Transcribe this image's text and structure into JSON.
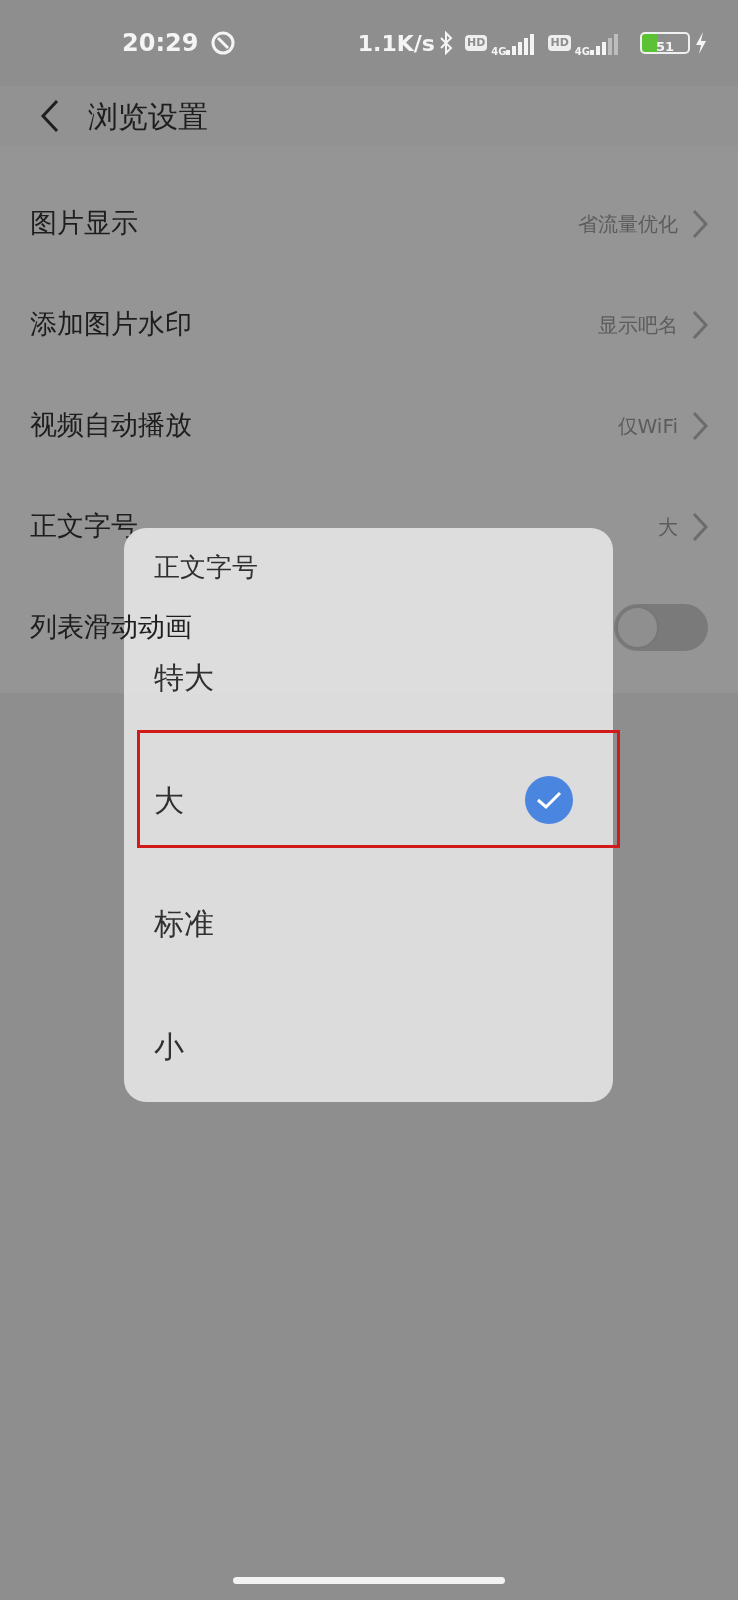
{
  "status_bar": {
    "time": "20:29",
    "speed": "1.1K/s",
    "sims": [
      {
        "hd": "HD",
        "network": "4G"
      },
      {
        "hd": "HD",
        "network": "4G"
      }
    ],
    "battery": "51"
  },
  "header": {
    "title": "浏览设置"
  },
  "settings": [
    {
      "kind": "link",
      "label": "图片显示",
      "value": "省流量优化"
    },
    {
      "kind": "link",
      "label": "添加图片水印",
      "value": "显示吧名"
    },
    {
      "kind": "link",
      "label": "视频自动播放",
      "value": "仅WiFi"
    },
    {
      "kind": "link",
      "label": "正文字号",
      "value": "大"
    },
    {
      "kind": "toggle",
      "label": "列表滑动动画",
      "on": false
    }
  ],
  "dialog": {
    "title": "正文字号",
    "options": [
      {
        "label": "特大",
        "selected": false,
        "annotated": false
      },
      {
        "label": "大",
        "selected": true,
        "annotated": true
      },
      {
        "label": "标准",
        "selected": false,
        "annotated": false
      },
      {
        "label": "小",
        "selected": false,
        "annotated": false
      }
    ]
  }
}
